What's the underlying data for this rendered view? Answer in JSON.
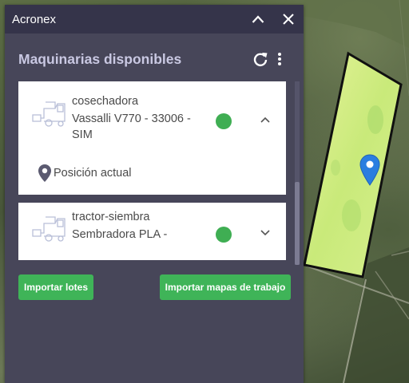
{
  "window": {
    "title": "Acronex"
  },
  "panel": {
    "title": "Maquinarias disponibles"
  },
  "machines": [
    {
      "type": "cosechadora",
      "name": "Vassalli V770 - 33006 - SIM",
      "status_color": "#3fae53",
      "expanded": true,
      "detail_label": "Posición actual"
    },
    {
      "type": "tractor-siembra",
      "name": "Sembradora PLA -",
      "status_color": "#3fae53",
      "expanded": false
    }
  ],
  "buttons": {
    "import_lots": "Importar lotes",
    "import_work_maps": "Importar mapas de trabajo"
  },
  "colors": {
    "panel_bg": "#474659",
    "titlebar_bg": "#35344a",
    "accent": "#3fb458",
    "status_green": "#3fae53",
    "pin_blue": "#2a7ee0"
  },
  "icons": [
    "chevron-up-icon",
    "close-icon",
    "refresh-icon",
    "more-vert-icon",
    "harvester-icon",
    "location-pin-icon",
    "chevron-down-icon",
    "map-marker-icon"
  ]
}
